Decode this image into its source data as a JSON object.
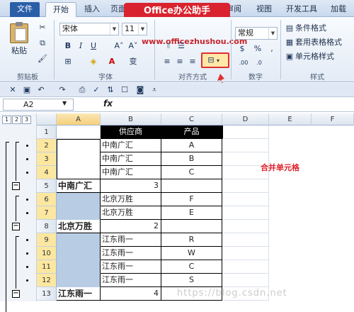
{
  "banner": "Office办公助手",
  "url": "www.officezhushou.com",
  "tabs": [
    "文件",
    "开始",
    "插入",
    "页面",
    "审阅",
    "视图",
    "开发工具",
    "加载"
  ],
  "ribbon": {
    "paste_label": "粘贴",
    "clipboard_label": "剪贴板",
    "font_name": "宋体",
    "font_size": "11",
    "font_label": "字体",
    "align_label": "对齐方式",
    "number_format": "常规",
    "number_label": "数字",
    "styles": [
      "条件格式",
      "套用表格格式",
      "单元格样式"
    ],
    "styles_label": "样式"
  },
  "formula_bar": {
    "name_box": "A2",
    "fx": "fx"
  },
  "outline_levels": [
    "1",
    "2",
    "3"
  ],
  "columns": [
    "A",
    "B",
    "C",
    "D",
    "E",
    "F"
  ],
  "table": {
    "header": {
      "supplier": "供应商",
      "product": "产品"
    },
    "rows": [
      {
        "num": "1",
        "a": "",
        "b": "",
        "c": ""
      },
      {
        "num": "2",
        "a": "",
        "b": "中南广汇",
        "c": "A"
      },
      {
        "num": "3",
        "a": "",
        "b": "中南广汇",
        "c": "B"
      },
      {
        "num": "4",
        "a": "",
        "b": "中南广汇",
        "c": "C"
      },
      {
        "num": "5",
        "a": "中南广汇",
        "b": "3",
        "c": ""
      },
      {
        "num": "6",
        "a": "",
        "b": "北京万胜",
        "c": "F"
      },
      {
        "num": "7",
        "a": "",
        "b": "北京万胜",
        "c": "E"
      },
      {
        "num": "8",
        "a": "北京万胜",
        "b": "2",
        "c": ""
      },
      {
        "num": "9",
        "a": "",
        "b": "江东雨一",
        "c": "R"
      },
      {
        "num": "10",
        "a": "",
        "b": "江东雨一",
        "c": "W"
      },
      {
        "num": "11",
        "a": "",
        "b": "江东雨一",
        "c": "C"
      },
      {
        "num": "12",
        "a": "",
        "b": "江东雨一",
        "c": "S"
      },
      {
        "num": "13",
        "a": "江东雨一",
        "b": "4",
        "c": ""
      }
    ]
  },
  "note": "合并单元格",
  "watermark": "https://blog.csdn.net",
  "colors": {
    "accent_red": "#e0202a",
    "merged_blue": "#b8cce4",
    "header_black": "#000000",
    "ribbon_blue": "#2a5ea8"
  }
}
